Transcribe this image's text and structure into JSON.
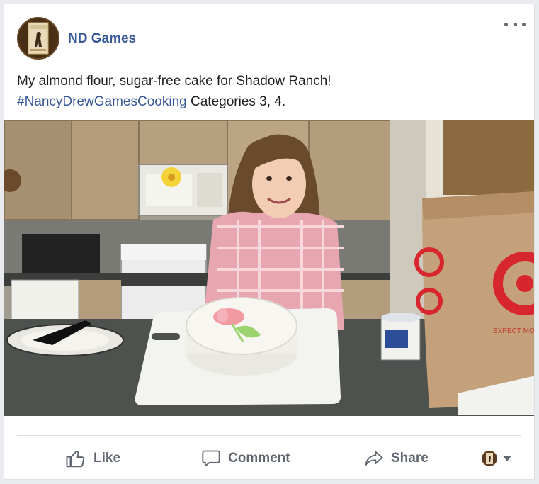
{
  "post": {
    "page_name": "ND Games",
    "text_line1": "My almond flour, sugar-free cake for Shadow Ranch!",
    "hashtag": "#NancyDrewGamesCooking",
    "text_suffix": " Categories 3, 4.",
    "avatar_icon": "nancy-drew-book-cover",
    "photo_bag_text": "EXPECT MO"
  },
  "actions": {
    "like_label": "Like",
    "comment_label": "Comment",
    "share_label": "Share"
  },
  "colors": {
    "link_blue": "#385898",
    "action_gray": "#606770",
    "target_red": "#d8262e"
  }
}
